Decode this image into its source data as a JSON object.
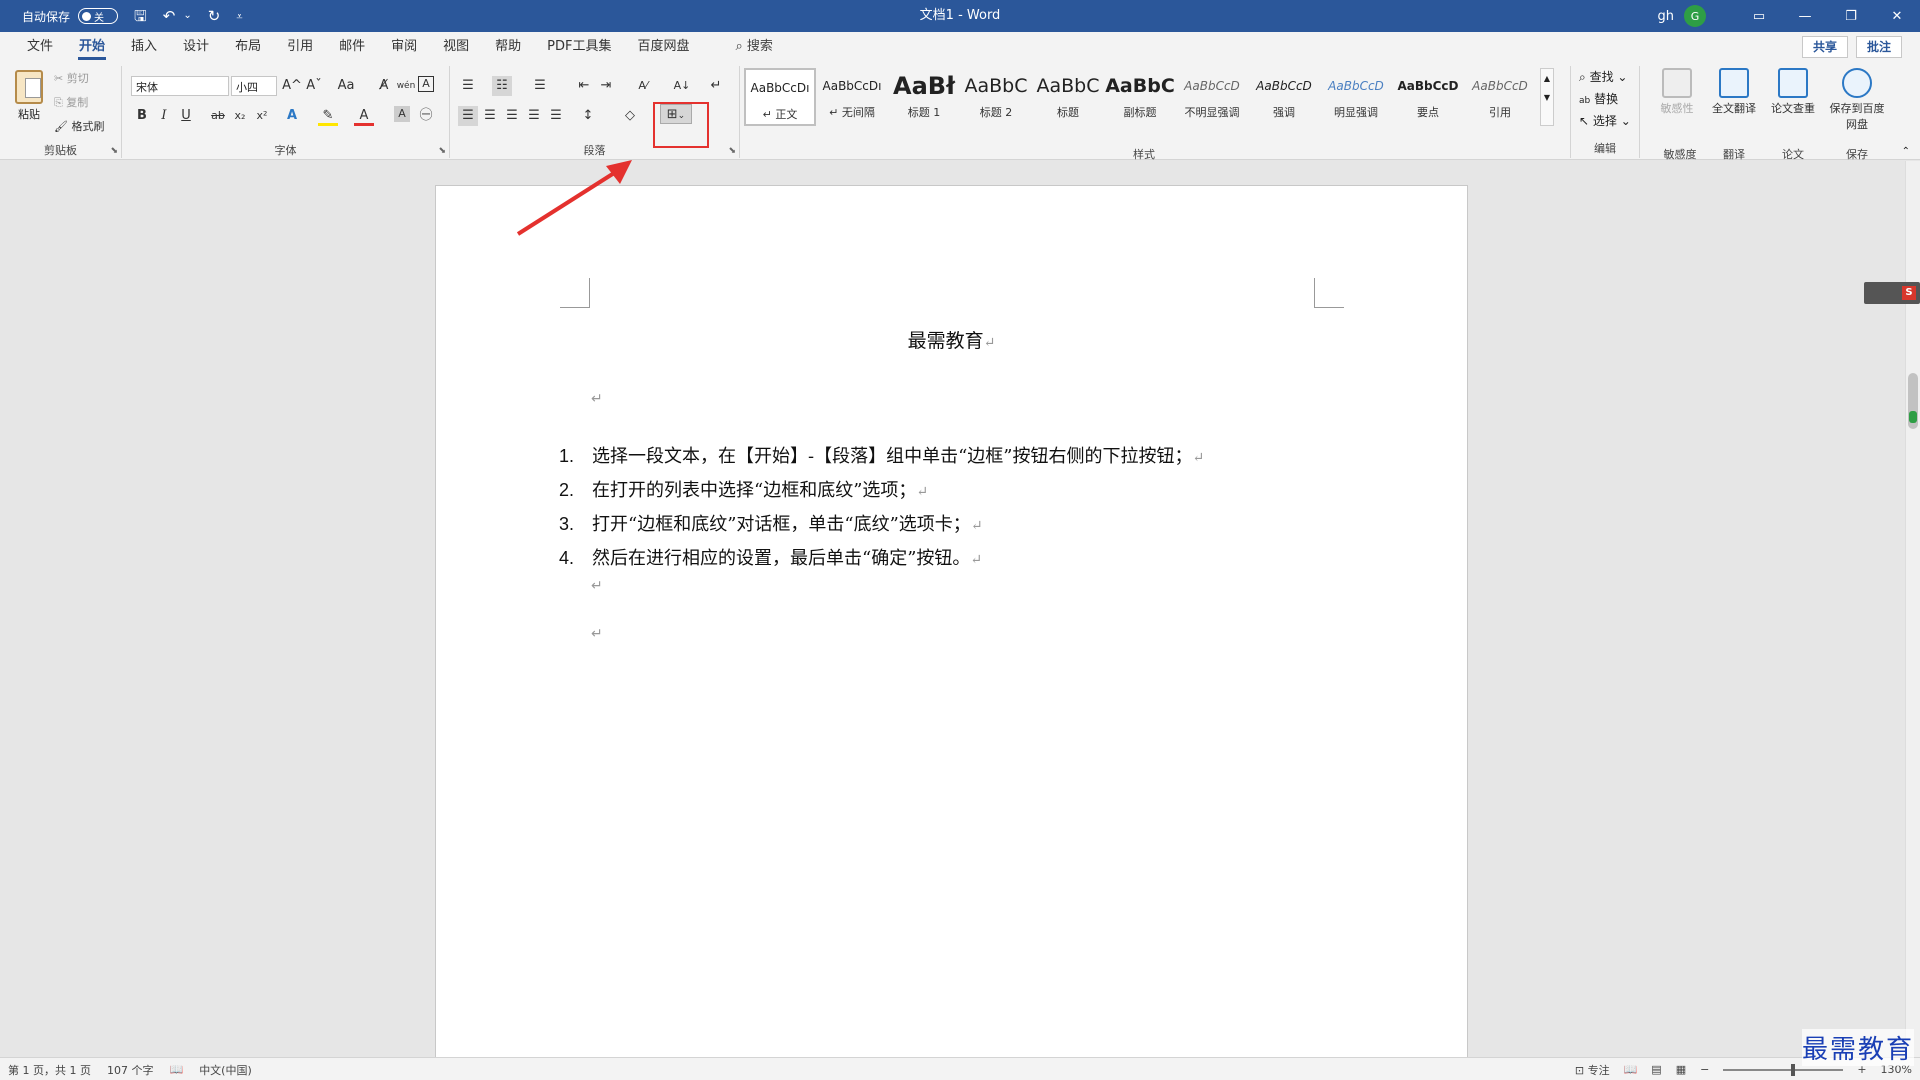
{
  "titlebar": {
    "autosave_label": "自动保存",
    "autosave_state": "关",
    "doc_title": "文档1 - Word",
    "user": "gh",
    "avatar_initial": "G",
    "icons": [
      "save-icon",
      "undo-icon",
      "redo-icon",
      "customize-icon",
      "ribbon-display-icon",
      "minimize-icon",
      "restore-icon",
      "close-icon"
    ],
    "qa": {
      "save": "🖫",
      "undo": "↶",
      "dropdown": "⌄",
      "redo": "↻",
      "customize": "⩡"
    },
    "win": {
      "ribbon": "▭",
      "minimize": "—",
      "restore": "❐",
      "close": "✕"
    }
  },
  "tabs": [
    "文件",
    "开始",
    "插入",
    "设计",
    "布局",
    "引用",
    "邮件",
    "审阅",
    "视图",
    "帮助",
    "PDF工具集",
    "百度网盘"
  ],
  "active_tab": "开始",
  "search_label": "搜索",
  "search_icon": "⌕",
  "share_label": "共享",
  "comment_label": "批注",
  "clipboard": {
    "paste": "粘贴",
    "cut": "剪切",
    "copy": "复制",
    "format_painter": "格式刷",
    "group": "剪贴板"
  },
  "font": {
    "name": "宋体",
    "size": "小四",
    "group": "字体",
    "buttons": {
      "grow": "A^",
      "shrink": "Aˇ",
      "case": "Aa",
      "clear": "A̸",
      "phonetic": "wén",
      "border": "A",
      "bold": "B",
      "italic": "I",
      "underline": "U",
      "strike": "ab",
      "sub": "x₂",
      "sup": "x²",
      "effects": "A",
      "highlight": "✎",
      "color": "A",
      "shading": "A",
      "enclose": "㊀"
    }
  },
  "paragraph": {
    "group": "段落",
    "buttons": {
      "bullets": "☰",
      "numbering": "☷",
      "multilevel": "☰",
      "decrease_indent": "⇤",
      "increase_indent": "⇥",
      "chinese_layout": "A⁄",
      "sort": "A↓",
      "show_marks": "↵",
      "align_left": "☰",
      "center": "☰",
      "align_right": "☰",
      "justify": "☰",
      "distributed": "☰",
      "line_spacing": "↕",
      "fill": "◇",
      "border": "⊞"
    }
  },
  "styles": {
    "group": "样式",
    "items": [
      {
        "sample": "AaBbCcDı",
        "name": "↵ 正文"
      },
      {
        "sample": "AaBbCcDı",
        "name": "↵ 无间隔"
      },
      {
        "sample": "AaBł",
        "name": "标题 1"
      },
      {
        "sample": "AaBbC",
        "name": "标题 2"
      },
      {
        "sample": "AaBbC",
        "name": "标题"
      },
      {
        "sample": "AaBbC",
        "name": "副标题"
      },
      {
        "sample": "AaBbCcD",
        "name": "不明显强调"
      },
      {
        "sample": "AaBbCcD",
        "name": "强调"
      },
      {
        "sample": "AaBbCcD",
        "name": "明显强调"
      },
      {
        "sample": "AaBbCcD",
        "name": "要点"
      },
      {
        "sample": "AaBbCcD",
        "name": "引用"
      }
    ]
  },
  "editing": {
    "find": "查找",
    "replace": "替换",
    "select": "选择",
    "group": "编辑",
    "icons": {
      "find": "⌕",
      "replace": "ab",
      "select": "↖"
    }
  },
  "sensitivity": {
    "label": "敏感性",
    "group": "敏感度"
  },
  "translate": {
    "label": "全文翻译",
    "group": "翻译"
  },
  "paper": {
    "label": "论文查重",
    "group": "论文"
  },
  "save_cloud": {
    "label": "保存到百度网盘",
    "group": "保存"
  },
  "document": {
    "title": "最需教育",
    "list": [
      {
        "num": "1.",
        "text": "选择一段文本，在【开始】-【段落】组中单击“边框”按钮右侧的下拉按钮；"
      },
      {
        "num": "2.",
        "text": "在打开的列表中选择“边框和底纹”选项；"
      },
      {
        "num": "3.",
        "text": "打开“边框和底纹”对话框，单击“底纹”选项卡；"
      },
      {
        "num": "4.",
        "text": "然后在进行相应的设置，最后单击“确定”按钮。"
      }
    ],
    "para_mark": "↵"
  },
  "statusbar": {
    "page": "第 1 页，共 1 页",
    "words": "107 个字",
    "proof_icon": "📖",
    "language": "中文(中国)",
    "focus": "专注",
    "zoom": "130%"
  },
  "watermark": "最需教育",
  "colors": {
    "accent": "#2b579a",
    "highlight_box": "#e4312e"
  }
}
